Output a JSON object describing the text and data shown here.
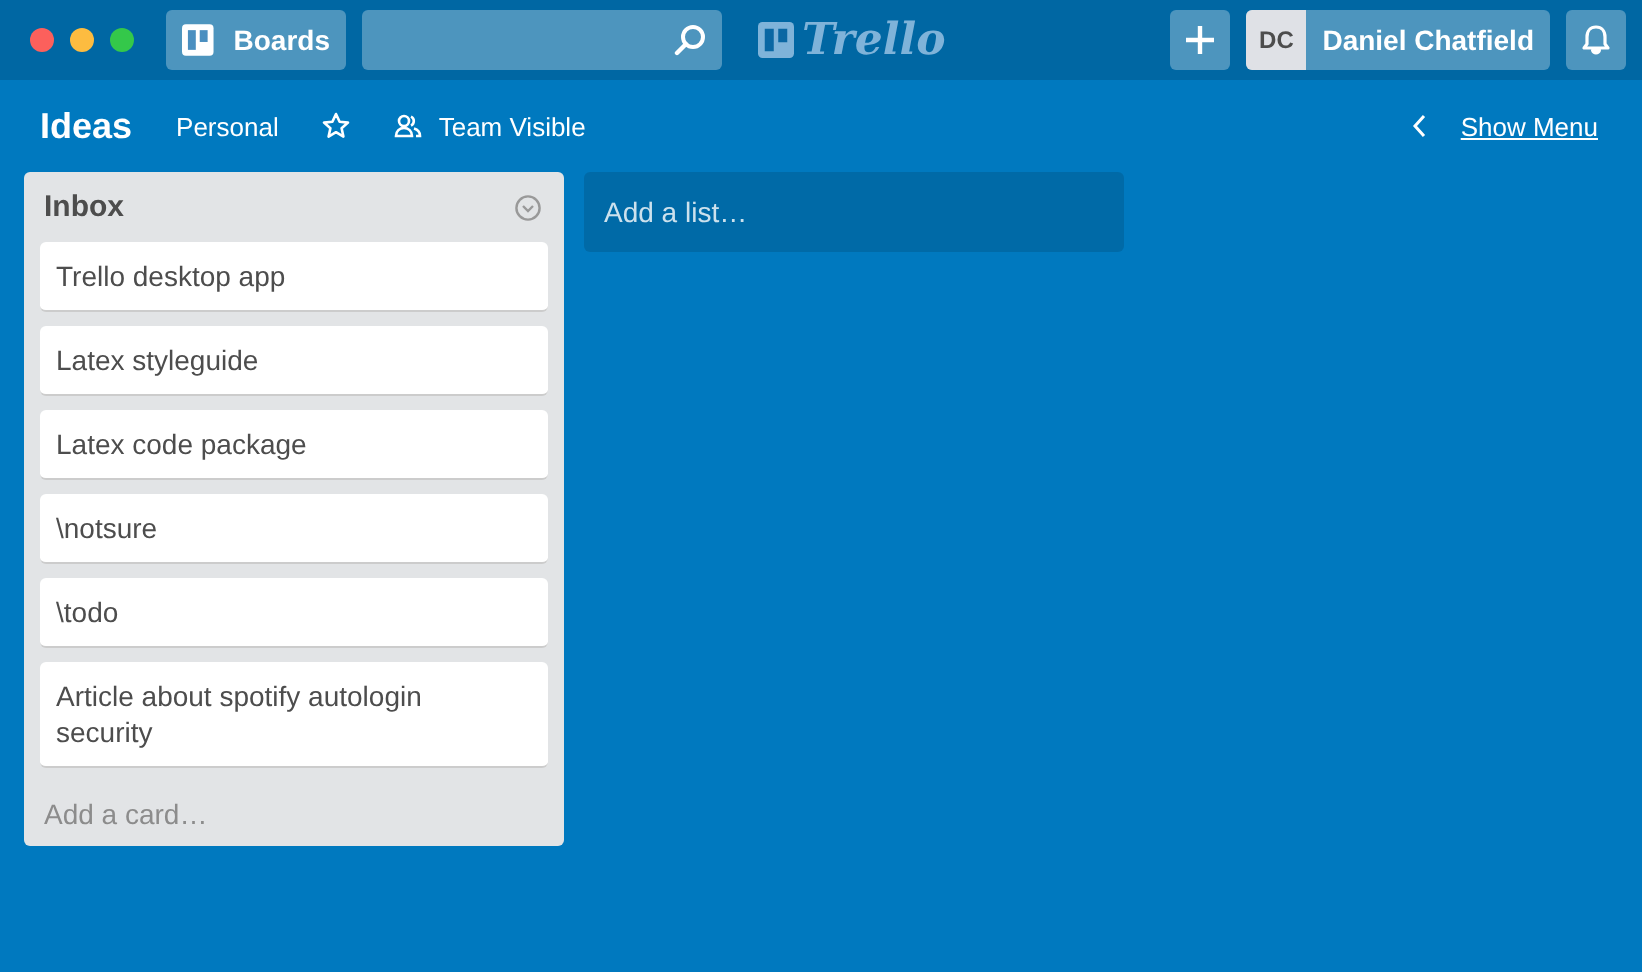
{
  "header": {
    "boards_button": "Boards",
    "logo": "Trello",
    "user": {
      "initials": "DC",
      "name": "Daniel Chatfield"
    }
  },
  "board": {
    "title": "Ideas",
    "team": "Personal",
    "starred": false,
    "visibility": "Team Visible",
    "show_menu": "Show Menu"
  },
  "lists": [
    {
      "title": "Inbox",
      "cards": [
        "Trello desktop app",
        "Latex styleguide",
        "Latex code package",
        "\\notsure",
        "\\todo",
        "Article about spotify autologin security"
      ],
      "add_card": "Add a card…"
    }
  ],
  "add_list": "Add a list…"
}
